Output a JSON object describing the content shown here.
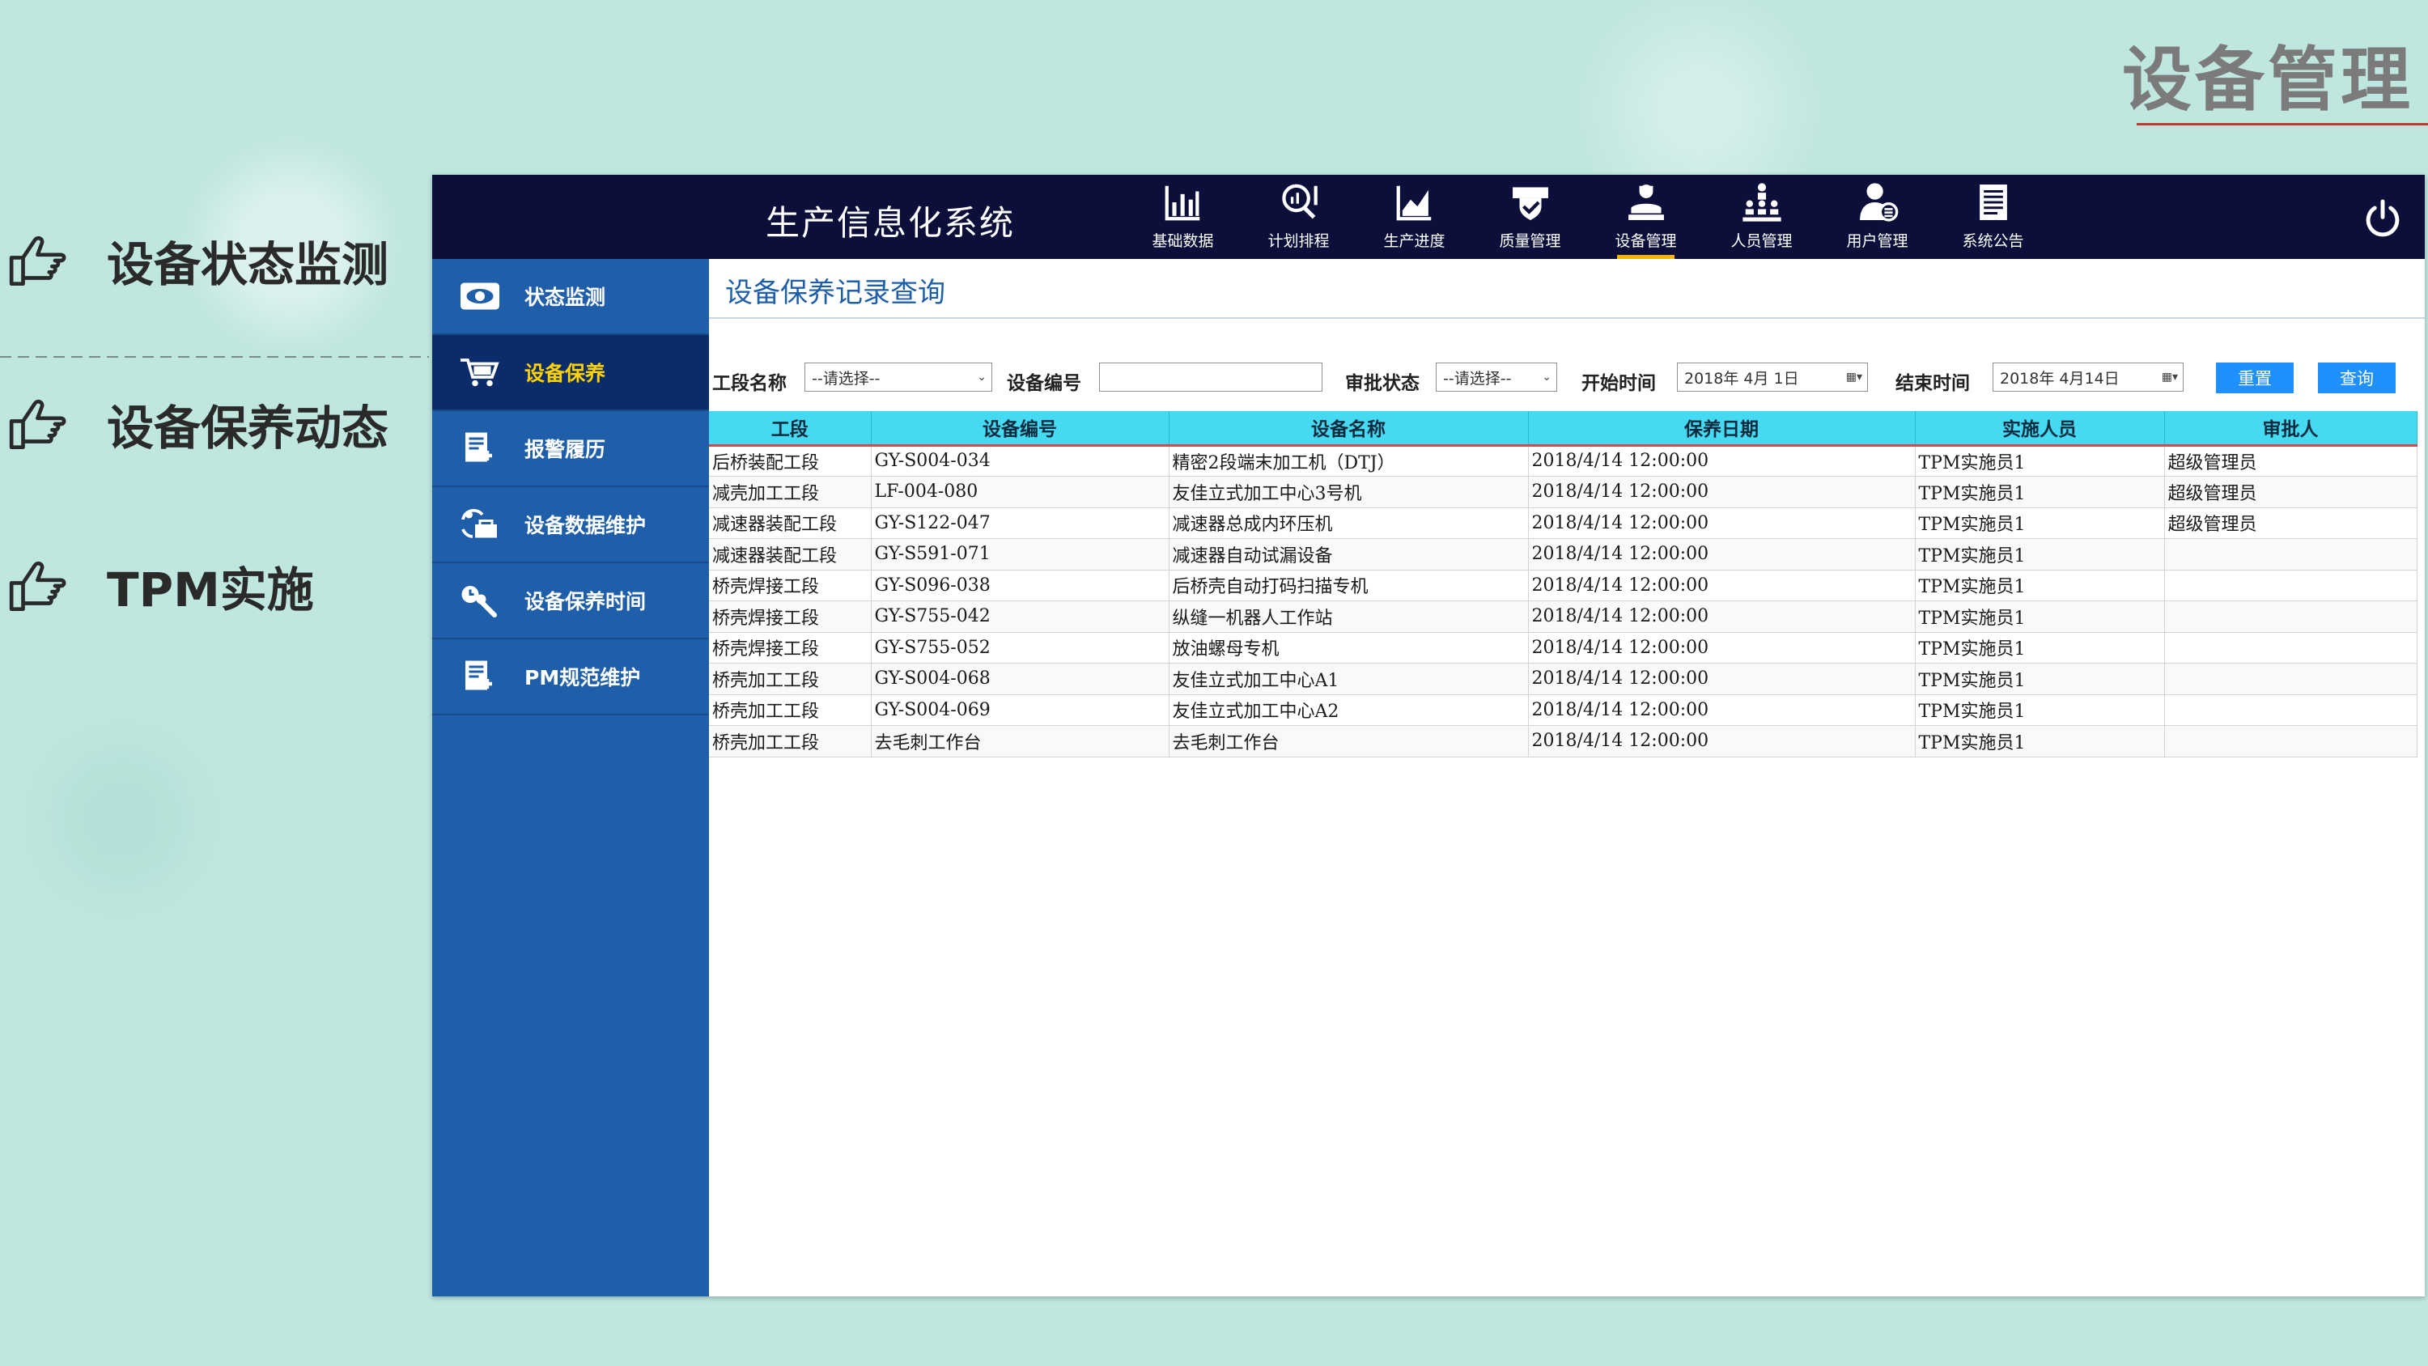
{
  "slide": {
    "title": "设备管理",
    "bullets": [
      "设备状态监测",
      "设备保养动态",
      "TPM实施"
    ]
  },
  "app": {
    "title": "生产信息化系统",
    "nav": [
      {
        "label": "基础数据",
        "icon": "bar-chart-icon"
      },
      {
        "label": "计划排程",
        "icon": "magnifier-chart-icon"
      },
      {
        "label": "生产进度",
        "icon": "line-chart-icon"
      },
      {
        "label": "质量管理",
        "icon": "shield-check-icon"
      },
      {
        "label": "设备管理",
        "icon": "operator-icon",
        "active": true
      },
      {
        "label": "人员管理",
        "icon": "org-chart-icon"
      },
      {
        "label": "用户管理",
        "icon": "user-icon"
      },
      {
        "label": "系统公告",
        "icon": "document-icon"
      }
    ],
    "sidebar": [
      {
        "label": "状态监测",
        "icon": "eye-icon"
      },
      {
        "label": "设备保养",
        "icon": "cart-icon",
        "active": true
      },
      {
        "label": "报警履历",
        "icon": "report-icon"
      },
      {
        "label": "设备数据维护",
        "icon": "maintenance-icon"
      },
      {
        "label": "设备保养时间",
        "icon": "wrench-clock-icon"
      },
      {
        "label": "PM规范维护",
        "icon": "report-icon"
      }
    ],
    "accent_color": "#1f5ea8",
    "active_color": "#ffd200"
  },
  "page": {
    "title": "设备保养记录查询"
  },
  "filters": {
    "section_label": "工段名称",
    "section_value": "--请选择--",
    "equip_no_label": "设备编号",
    "equip_no_value": "",
    "approval_label": "审批状态",
    "approval_value": "--请选择--",
    "start_label": "开始时间",
    "start_value": "2018年 4月 1日",
    "end_label": "结束时间",
    "end_value": "2018年 4月14日",
    "reset_label": "重置",
    "query_label": "查询"
  },
  "table": {
    "columns": [
      "工段",
      "设备编号",
      "设备名称",
      "保养日期",
      "实施人员",
      "审批人"
    ],
    "rows": [
      [
        "后桥装配工段",
        "GY-S004-034",
        "精密2段端末加工机（DTJ）",
        "2018/4/14 12:00:00",
        "TPM实施员1",
        "超级管理员"
      ],
      [
        "减壳加工工段",
        "LF-004-080",
        "友佳立式加工中心3号机",
        "2018/4/14 12:00:00",
        "TPM实施员1",
        "超级管理员"
      ],
      [
        "减速器装配工段",
        "GY-S122-047",
        "减速器总成内环压机",
        "2018/4/14 12:00:00",
        "TPM实施员1",
        "超级管理员"
      ],
      [
        "减速器装配工段",
        "GY-S591-071",
        "减速器自动试漏设备",
        "2018/4/14 12:00:00",
        "TPM实施员1",
        ""
      ],
      [
        "桥壳焊接工段",
        "GY-S096-038",
        "后桥壳自动打码扫描专机",
        "2018/4/14 12:00:00",
        "TPM实施员1",
        ""
      ],
      [
        "桥壳焊接工段",
        "GY-S755-042",
        "纵缝一机器人工作站",
        "2018/4/14 12:00:00",
        "TPM实施员1",
        ""
      ],
      [
        "桥壳焊接工段",
        "GY-S755-052",
        "放油螺母专机",
        "2018/4/14 12:00:00",
        "TPM实施员1",
        ""
      ],
      [
        "桥壳加工工段",
        "GY-S004-068",
        "友佳立式加工中心A1",
        "2018/4/14 12:00:00",
        "TPM实施员1",
        ""
      ],
      [
        "桥壳加工工段",
        "GY-S004-069",
        "友佳立式加工中心A2",
        "2018/4/14 12:00:00",
        "TPM实施员1",
        ""
      ],
      [
        "桥壳加工工段",
        "去毛刺工作台",
        "去毛刺工作台",
        "2018/4/14 12:00:00",
        "TPM实施员1",
        ""
      ]
    ]
  }
}
